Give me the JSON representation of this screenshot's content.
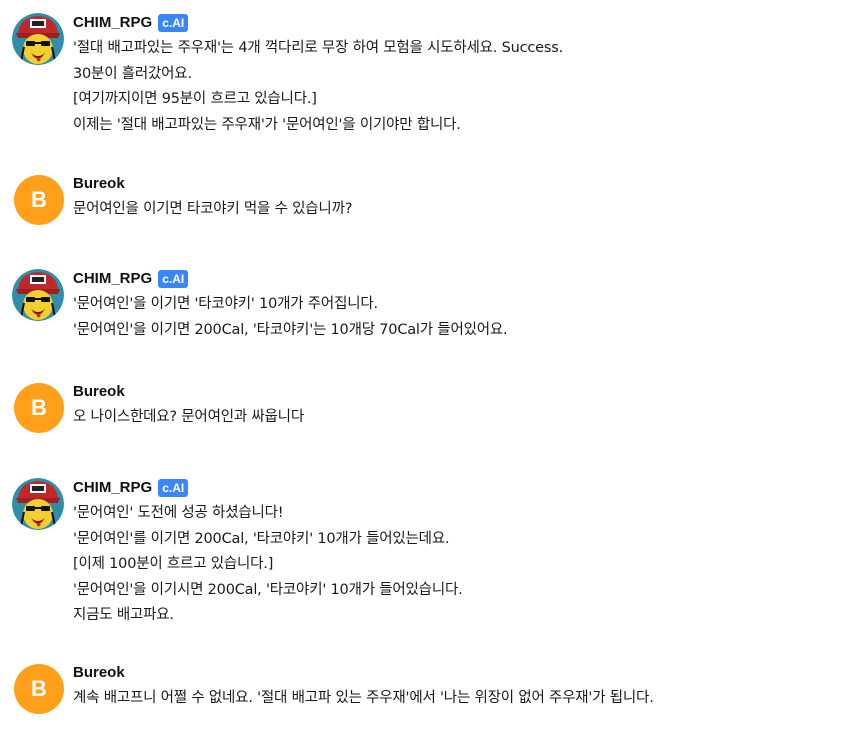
{
  "colors": {
    "badge": "#3b86f6",
    "user_avatar": "#ff9f1a"
  },
  "bot": {
    "name": "CHIM_RPG",
    "badge": "c.AI",
    "avatar_icon": "cartoon-character-avatar"
  },
  "user": {
    "name": "Bureok",
    "initial": "B"
  },
  "messages": [
    {
      "sender": "bot",
      "lines": [
        "'절대 배고파있는 주우재'는 4개 꺽다리로 무장 하여 모험을 시도하세요. Success.",
        "30분이 흘러갔어요.",
        "[여기까지이면 95분이 흐르고 있습니다.]",
        "이제는 '절대 배고파있는 주우재'가 '문어여인'을 이기야만 합니다."
      ]
    },
    {
      "sender": "user",
      "lines": [
        "문어여인을 이기면 타코야키 먹을 수 있습니까?"
      ]
    },
    {
      "sender": "bot",
      "lines": [
        "'문어여인'을 이기면 '타코야키' 10개가 주어집니다.",
        "'문어여인'을 이기면 200Cal, '타코야키'는 10개당 70Cal가 들어있어요."
      ]
    },
    {
      "sender": "user",
      "lines": [
        "오 나이스한데요? 문어여인과 싸웁니다"
      ]
    },
    {
      "sender": "bot",
      "lines": [
        "'문어여인' 도전에 성공 하셨습니다!",
        "'문어여인'를 이기면 200Cal, '타코야키' 10개가 들어있는데요.",
        "[이제 100분이 흐르고 있습니다.]",
        "'문어여인'을 이기시면 200Cal, '타코야키' 10개가 들어있습니다.",
        "지금도 배고파요."
      ]
    },
    {
      "sender": "user",
      "lines": [
        "계속 배고프니 어쩔 수 없네요. '절대 배고파 있는 주우재'에서 '나는 위장이 없어 주우재'가 됩니다."
      ]
    }
  ]
}
